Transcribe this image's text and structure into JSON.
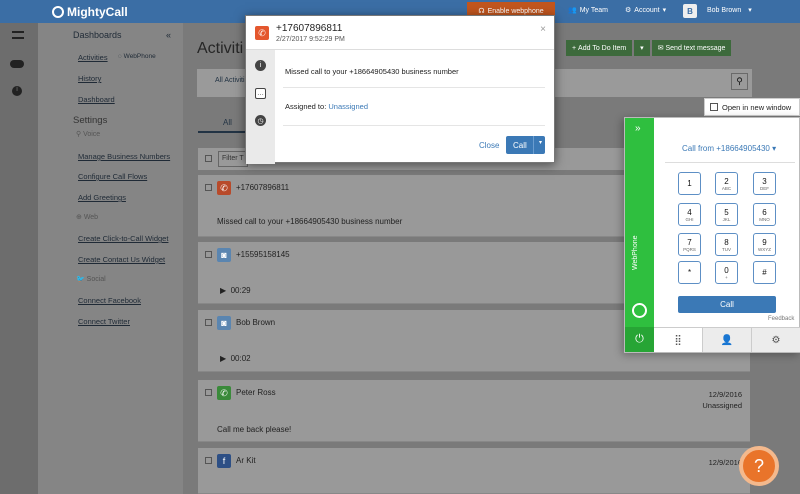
{
  "topbar": {
    "logo": "MightyCall",
    "enable_webphone": "Enable webphone",
    "my_team": "My Team",
    "account": "Account",
    "user": "Bob Brown",
    "avatar_letter": "B"
  },
  "sidebar": {
    "header": "Dashboards",
    "collapse": "«",
    "activities": "Activities",
    "webphone": "WebPhone",
    "history": "History",
    "dashboard": "Dashboard",
    "settings": "Settings",
    "voice": "Voice",
    "manage_numbers": "Manage Business Numbers",
    "configure_flows": "Configure Call Flows",
    "add_greetings": "Add Greetings",
    "web": "Web",
    "click_to_call": "Create Click-to-Call Widget",
    "contact_us": "Create Contact Us Widget",
    "social": "Social",
    "facebook": "Connect Facebook",
    "twitter": "Connect Twitter"
  },
  "main": {
    "title": "Activiti",
    "tab_all_activities": "All Activiti",
    "all_tab": "All",
    "filter": "Filter T",
    "add_todo": "Add To Do Item",
    "send_text": "Send text message"
  },
  "activities": [
    {
      "name": "+17607896811",
      "message": "Missed call to your +18664905430 business number"
    },
    {
      "name": "+15595158145",
      "duration": "00:29"
    },
    {
      "name": "Bob Brown",
      "duration": "00:02"
    },
    {
      "name": "Peter Ross",
      "message": "Call me back please!",
      "date": "12/9/2016",
      "assigned": "Unassigned"
    },
    {
      "name": "Ar Kit",
      "date": "12/9/2016"
    }
  ],
  "popup": {
    "number": "+17607896811",
    "datetime": "2/27/2017 9:52:29 PM",
    "close_x": "×",
    "message": "Missed call to your +18664905430 business number",
    "assigned_label": "Assigned to:",
    "assigned_value": "Unassigned",
    "close": "Close",
    "call": "Call"
  },
  "open_new_window": "Open in new window",
  "webphone": {
    "label": "WebPhone",
    "call_from_label": "Call from",
    "call_from_number": "+18664905430",
    "call": "Call",
    "feedback": "Feedback",
    "keys": [
      {
        "d": "1",
        "l": ""
      },
      {
        "d": "2",
        "l": "ABC"
      },
      {
        "d": "3",
        "l": "DEF"
      },
      {
        "d": "4",
        "l": "GHI"
      },
      {
        "d": "5",
        "l": "JKL"
      },
      {
        "d": "6",
        "l": "MNO"
      },
      {
        "d": "7",
        "l": "PQRS"
      },
      {
        "d": "8",
        "l": "TUV"
      },
      {
        "d": "9",
        "l": "WXYZ"
      },
      {
        "d": "*",
        "l": ""
      },
      {
        "d": "0",
        "l": "+"
      },
      {
        "d": "#",
        "l": ""
      }
    ]
  },
  "help": "?"
}
